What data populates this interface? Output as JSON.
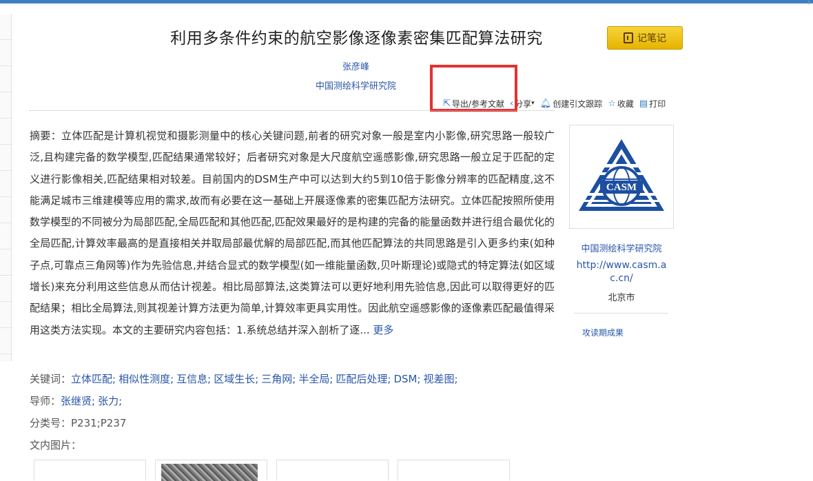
{
  "header": {
    "title": "利用多条件约束的航空影像逐像素密集匹配算法研究",
    "note_button": "记笔记",
    "corner_text": "|"
  },
  "authors": [
    "张彦峰"
  ],
  "institution": "中国测绘科学研究院",
  "toolbar": [
    {
      "label": "导出/参考文献",
      "icon": "export-icon"
    },
    {
      "label": "分享",
      "icon": "share-icon",
      "caret": "▾"
    },
    {
      "label": "创建引文跟踪",
      "icon": "bell-icon"
    },
    {
      "label": "收藏",
      "icon": "star-icon"
    },
    {
      "label": "打印",
      "icon": "printer-icon"
    }
  ],
  "highlight_color": "#e53030",
  "abstract": {
    "text": "摘要：立体匹配是计算机视觉和摄影测量中的核心关键问题,前者的研究对象一般是室内小影像,研究思路一般较广泛,且构建完备的数学模型,匹配结果通常较好；后者研究对象是大尺度航空遥感影像,研究思路一般立足于匹配的定义进行影像相关,匹配结果相对较差。目前国内的DSM生产中可以达到大约5到10倍于影像分辨率的匹配精度,这不能满足城市三维建模等应用的需求,故而有必要在这一基础上开展逐像素的密集匹配方法研究。立体匹配按照所使用数学模型的不同被分为局部匹配,全局匹配和其他匹配,匹配效果最好的是构建的完备的能量函数并进行组合最优化的全局匹配,计算效率最高的是直接相关并取局部最优解的局部匹配,而其他匹配算法的共同思路是引入更多约束(如种子点,可靠点三角网等)作为先验信息,并结合显式的数学模型(如一维能量函数,贝叶斯理论)或隐式的特定算法(如区域增长)来充分利用这些信息从而估计视差。相比局部算法,这类算法可以更好地利用先验信息,因此可以取得更好的匹配结果；相比全局算法,则其视差计算方法更为简单,计算效率更具实用性。因此航空遥感影像的逐像素匹配最值得采用这类方法实现。本文的主要研究内容包括：1.系统总结并深入剖析了逐...",
    "more": "更多"
  },
  "keywords": {
    "label": "关键词：",
    "items": [
      "立体匹配;",
      "相似性测度;",
      "互信息;",
      "区域生长;",
      "三角网;",
      "半全局;",
      "匹配后处理;",
      "DSM;",
      "视差图;"
    ]
  },
  "advisors": {
    "label": "导师：",
    "items": [
      "张继贤;",
      "张力;"
    ]
  },
  "classification": {
    "label": "分类号：",
    "value": "P231;P237"
  },
  "figures_label": "文内图片：",
  "sidebar": {
    "logo_text": "CASM",
    "org_name": "中国测绘科学研究院",
    "url": "http://www.casm.ac.cn/",
    "city": "北京市",
    "link": "攻读期成果"
  }
}
